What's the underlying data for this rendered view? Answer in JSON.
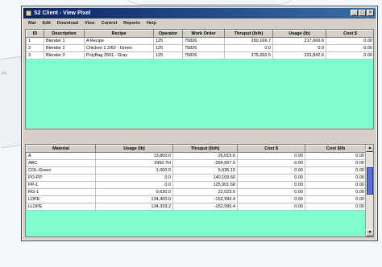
{
  "window": {
    "title": "S2 Client - View Pixel",
    "buttons": [
      "_",
      "□",
      "×"
    ]
  },
  "menu": [
    "Mat",
    "Edit",
    "Download",
    "View",
    "Control",
    "Reports",
    "Help"
  ],
  "background": {
    "label": "Pri"
  },
  "top_table": {
    "headers": [
      "ID",
      "Description",
      "Recipe",
      "Operator",
      "Work Order",
      "Thruput (lb/h)",
      "Usage (lb)",
      "Cost $"
    ],
    "rows": [
      [
        "1",
        "Blender 1",
        "A Recipe",
        "125",
        "75826",
        "260,166.7",
        "217,666.6",
        "0.00"
      ],
      [
        "2",
        "Blender 2",
        "Chicken 1 2/60 - Green",
        "125",
        "75826",
        "0.0",
        "0.0",
        "0.00"
      ],
      [
        "3",
        "Blender 3",
        "PolyBag 2501 - Gray",
        "125",
        "75826",
        "375,260.5",
        "231,842.6",
        "0.00"
      ]
    ]
  },
  "bottom_table": {
    "headers": [
      "Material",
      "Usage (lb)",
      "Thruput (lb/h)",
      "Cost $",
      "Cost $/lb"
    ],
    "rows": [
      [
        "A",
        "13,800.0",
        "26,015.6",
        "0.00",
        "0.00"
      ],
      [
        "ABC",
        "2950.7H",
        "-264,667.0",
        "0.00",
        "0.00"
      ],
      [
        "COL-Green",
        "1,000.0",
        "5,036.10",
        "0.00",
        "0.00"
      ],
      [
        "PO-PP",
        "0.0",
        "140,109.60",
        "0.00",
        "0.00"
      ],
      [
        "PP-1",
        "0.0",
        "125,901.60",
        "0.00",
        "0.00"
      ],
      [
        "RG-1",
        "9,630.0",
        "22,023.6",
        "0.00",
        "0.00"
      ],
      [
        "LDPE",
        "134,400.0",
        "-152,996.4",
        "0.00",
        "0.00"
      ],
      [
        "LLDPE",
        "134,333.2",
        "-152,996.4",
        "0.00",
        "0.00"
      ]
    ]
  },
  "colors": {
    "pane_background": "#7fffd0",
    "titlebar_start": "#0a246a",
    "titlebar_end": "#3a6ea5",
    "scroll_thumb": "#5b6fd6"
  },
  "icons": {
    "app": "window-app-icon",
    "scroll_up": "scroll-up-arrow-icon",
    "scroll_down": "scroll-down-arrow-icon"
  }
}
